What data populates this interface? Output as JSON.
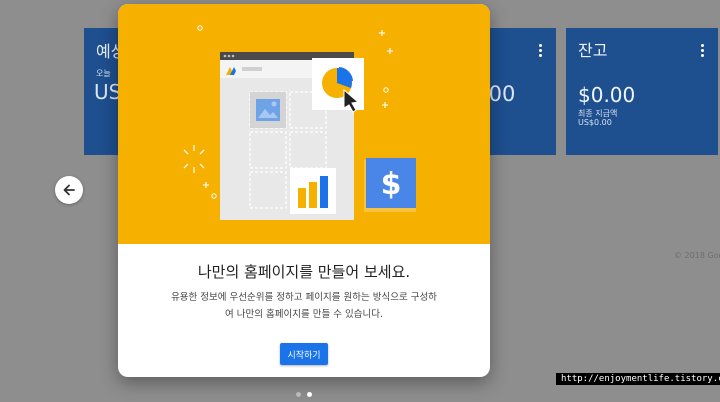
{
  "cards": {
    "left": {
      "title": "예상",
      "sub": "오늘",
      "amount": "US"
    },
    "middle": {
      "amount": ".00"
    },
    "right": {
      "title": "잔고",
      "amount": "$0.00",
      "label1": "최종 지급액",
      "label2": "US$0.00"
    }
  },
  "footer": {
    "copyright": "© 2018 Goo"
  },
  "modal": {
    "title": "나만의 홈페이지를 만들어 보세요.",
    "description_line1": "유용한 정보에 우선순위를 정하고 페이지를 원하는 방식으로 구성하",
    "description_line2": "여 나만의 홈페이지를 만들 수 있습니다.",
    "start_button": "시작하기"
  },
  "icons": {
    "back": "arrow-left-icon",
    "dollar": "dollar-icon",
    "pie": "pie-chart-icon",
    "bar": "bar-chart-icon",
    "image": "image-icon",
    "cursor": "cursor-icon",
    "kebab": "more-vert-icon"
  },
  "colors": {
    "hero_bg": "#f6b000",
    "card_bg": "#1e4f8f",
    "button": "#1a73e8"
  },
  "pagination": {
    "total": 2,
    "current": 2
  },
  "watermark": "http://enjoymentlife.tistory.com"
}
